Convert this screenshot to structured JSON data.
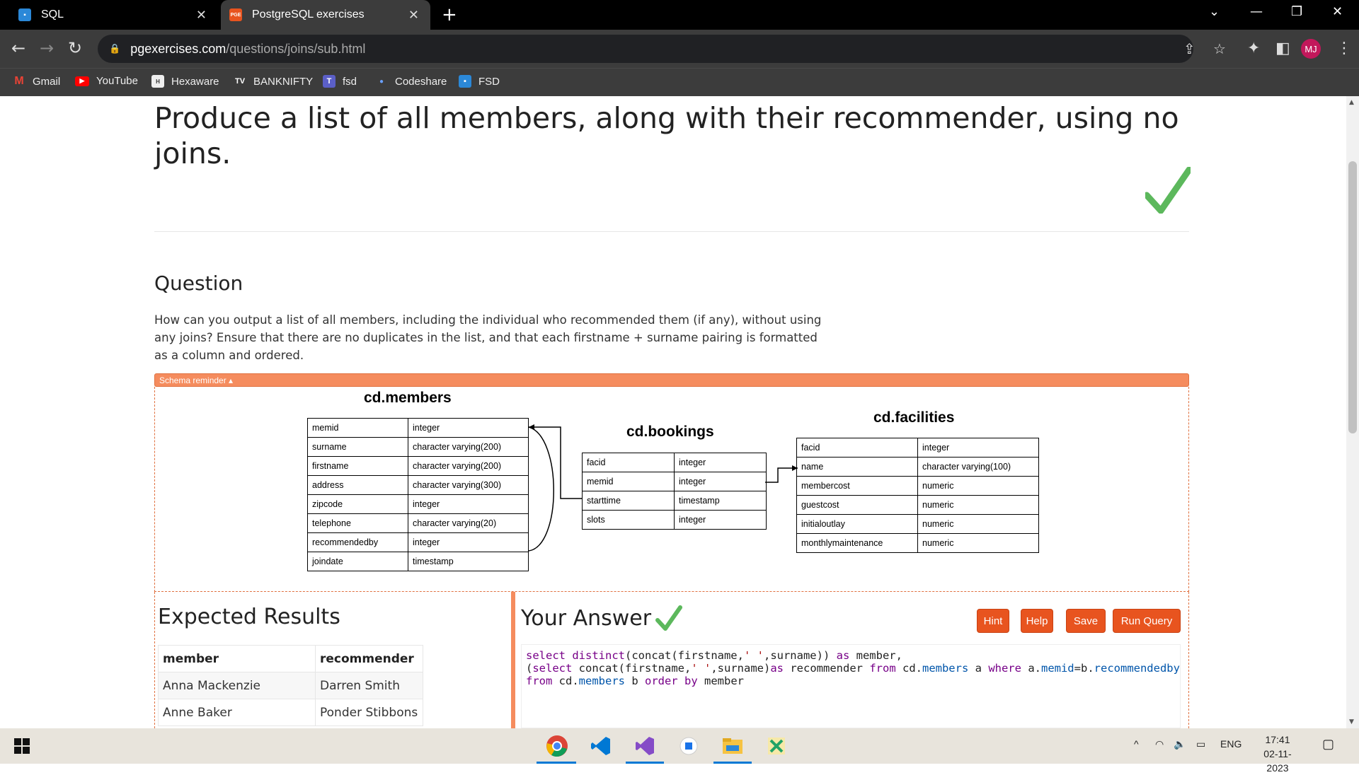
{
  "browser": {
    "tabs": [
      {
        "label": "SQL",
        "active": false
      },
      {
        "label": "PostgreSQL exercises",
        "active": true
      }
    ],
    "new_tab_icon": "plus-icon",
    "url_host": "pgexercises.com",
    "url_path": "/questions/joins/sub.html",
    "profile_initials": "MJ",
    "bookmarks": [
      {
        "label": "Gmail",
        "icon": "gmail-icon"
      },
      {
        "label": "YouTube",
        "icon": "youtube-icon"
      },
      {
        "label": "Hexaware",
        "icon": "hexaware-icon"
      },
      {
        "label": "BANKNIFTY",
        "icon": "tradingview-icon"
      },
      {
        "label": "fsd",
        "icon": "teams-icon"
      },
      {
        "label": "Codeshare",
        "icon": "dot-icon"
      },
      {
        "label": "FSD",
        "icon": "bookmark-icon"
      }
    ]
  },
  "page": {
    "title": "Produce a list of all members, along with their recommender, using no joins.",
    "question_heading": "Question",
    "question_text": "How can you output a list of all members, including the individual who recommended them (if any), without using any joins? Ensure that there are no duplicates in the list, and that each firstname + surname pairing is formatted as a column and ordered.",
    "schema_toggle": "Schema reminder ▴",
    "schema": {
      "members": {
        "title": "cd.members",
        "rows": [
          [
            "memid",
            "integer"
          ],
          [
            "surname",
            "character varying(200)"
          ],
          [
            "firstname",
            "character varying(200)"
          ],
          [
            "address",
            "character varying(300)"
          ],
          [
            "zipcode",
            "integer"
          ],
          [
            "telephone",
            "character varying(20)"
          ],
          [
            "recommendedby",
            "integer"
          ],
          [
            "joindate",
            "timestamp"
          ]
        ]
      },
      "bookings": {
        "title": "cd.bookings",
        "rows": [
          [
            "facid",
            "integer"
          ],
          [
            "memid",
            "integer"
          ],
          [
            "starttime",
            "timestamp"
          ],
          [
            "slots",
            "integer"
          ]
        ]
      },
      "facilities": {
        "title": "cd.facilities",
        "rows": [
          [
            "facid",
            "integer"
          ],
          [
            "name",
            "character varying(100)"
          ],
          [
            "membercost",
            "numeric"
          ],
          [
            "guestcost",
            "numeric"
          ],
          [
            "initialoutlay",
            "numeric"
          ],
          [
            "monthlymaintenance",
            "numeric"
          ]
        ]
      }
    },
    "expected": {
      "title": "Expected Results",
      "headers": [
        "member",
        "recommender"
      ],
      "rows": [
        [
          "Anna Mackenzie",
          "Darren Smith"
        ],
        [
          "Anne Baker",
          "Ponder Stibbons"
        ]
      ]
    },
    "answer": {
      "title": "Your Answer",
      "buttons": {
        "hint": "Hint",
        "help": "Help",
        "save": "Save",
        "run": "Run Query"
      },
      "code_lines": [
        "select distinct(concat(firstname,' ',surname)) as member,",
        "(select concat(firstname,' ',surname)as recommender from cd.members a where a.memid=b.recommendedby)",
        "from cd.members b order by member"
      ]
    }
  },
  "taskbar": {
    "apps": [
      "chrome-icon",
      "vscode-icon",
      "visual-studio-icon",
      "app-icon",
      "file-explorer-icon",
      "excel-icon"
    ],
    "language": "ENG",
    "time": "17:41",
    "date": "02-11-2023"
  },
  "colors": {
    "accent": "#f58c5e",
    "button": "#e8541f",
    "check": "#5cb85c"
  }
}
